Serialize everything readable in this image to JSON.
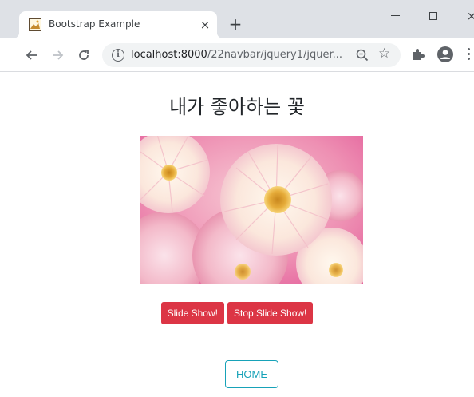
{
  "browser": {
    "tab_title": "Bootstrap Example",
    "tab_close": "×",
    "new_tab": "+",
    "window_close": "×",
    "url_host": "localhost:8000",
    "url_path": "/22navbar/jquery1/jquer...",
    "url_path_short": "/22navbar/jquery1/jquer...",
    "icons": [
      "back-arrow-icon",
      "forward-arrow-icon",
      "reload-icon",
      "site-info-icon",
      "zoom-icon",
      "bookmark-star-icon",
      "extensions-puzzle-icon",
      "profile-avatar-icon",
      "kebab-menu-icon"
    ]
  },
  "page": {
    "heading": "내가 좋아하는 꽃",
    "image_description": "pink and cream dahlia flowers",
    "buttons": {
      "slide_show": "Slide Show!",
      "stop_slide_show": "Stop Slide Show!",
      "home": "HOME"
    }
  },
  "colors": {
    "danger": "#dc3545",
    "info": "#17a2b8",
    "chrome_bg": "#dee1e6",
    "omnibox_bg": "#f1f3f4"
  }
}
